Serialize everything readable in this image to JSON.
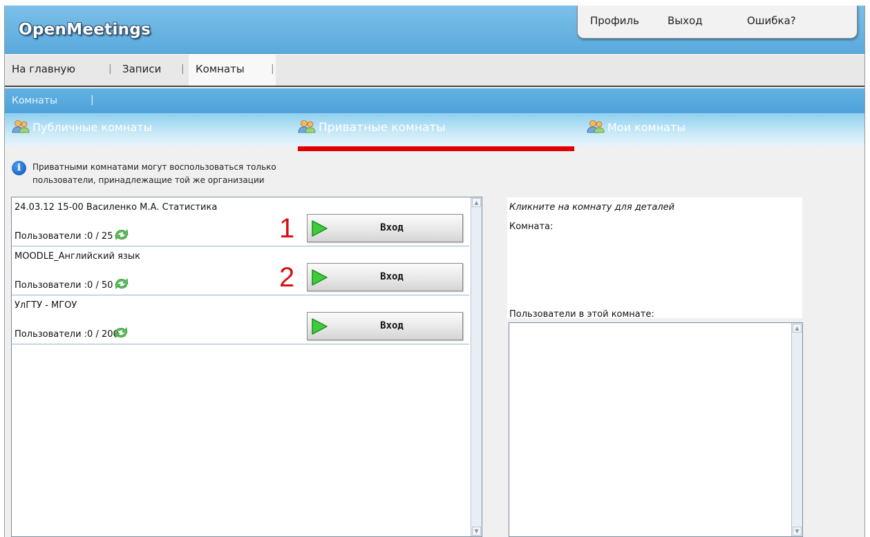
{
  "app": {
    "logo": "OpenMeetings"
  },
  "user_menu": {
    "profile": "Профиль",
    "logout": "Выход",
    "bug": "Ошибка?"
  },
  "main_nav": [
    {
      "label": "На главную"
    },
    {
      "label": "Записи"
    },
    {
      "label": "Комнаты",
      "active": true
    }
  ],
  "sub_nav": {
    "label": "Комнаты",
    "sep": "|"
  },
  "tabs": [
    {
      "label": "Публичные комнаты",
      "icon": "users-icon"
    },
    {
      "label": "Приватные комнаты",
      "icon": "users-icon",
      "active": true
    },
    {
      "label": "Мои комнаты",
      "icon": "users-icon"
    }
  ],
  "info": {
    "text_line1": "Приватными комнатами могут воспользоваться только",
    "text_line2": "пользователи, принадлежащие той же организации"
  },
  "rooms": [
    {
      "name": "24.03.12 15-00 Василенко М.А. Статистика",
      "users": "Пользователи :0 / 25",
      "button": "Вход",
      "marker": "1"
    },
    {
      "name": "MOODLE_Английский язык",
      "users": "Пользователи :0 / 50",
      "button": "Вход",
      "marker": "2"
    },
    {
      "name": "УлГТУ - МГОУ",
      "users": "Пользователи :0 / 200",
      "button": "Вход",
      "marker": ""
    }
  ],
  "details": {
    "hint": "Кликните на комнату для деталей",
    "room_label": "Комната:",
    "users_label": "Пользователи в этой комнате:"
  },
  "colors": {
    "header": "#5aa9dd",
    "accent_red": "#e00000",
    "play_green": "#2fbf2f"
  }
}
